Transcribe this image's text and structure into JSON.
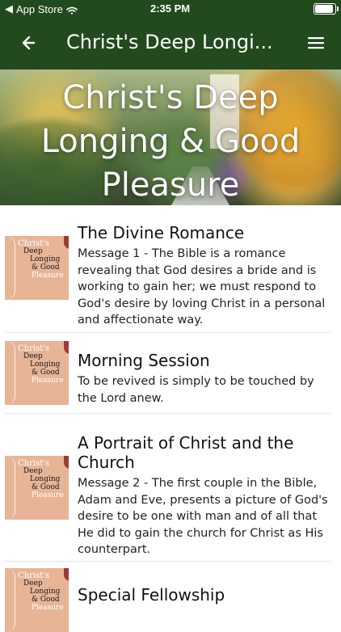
{
  "status_bar": {
    "back_label": "App Store",
    "time": "2:35 PM"
  },
  "header": {
    "title": "Christ's Deep Longi..."
  },
  "hero": {
    "title_lines": [
      "Christ's Deep",
      "Longing & Good",
      "Pleasure"
    ]
  },
  "thumbnail": {
    "line1": "Christ's",
    "line2": "Deep",
    "line3": "Longing",
    "line4": "& Good",
    "line5": "Pleasure"
  },
  "items": [
    {
      "title": "The Divine Romance",
      "description": "Message 1 - The Bible is a romance revealing that God desires a bride and is working to gain her; we must respond to God's desire by loving Christ in a personal and affectionate way."
    },
    {
      "title": "Morning Session",
      "description": "To be revived is simply to be touched by the Lord anew."
    },
    {
      "title": "A Portrait of Christ and the Church",
      "description": "Message 2 - The first couple in the Bible, Adam and Eve, presents a picture of God's desire to be one with man and of all that He did to gain the church for Christ as His counterpart."
    },
    {
      "title": "Special Fellowship",
      "description": ""
    }
  ]
}
